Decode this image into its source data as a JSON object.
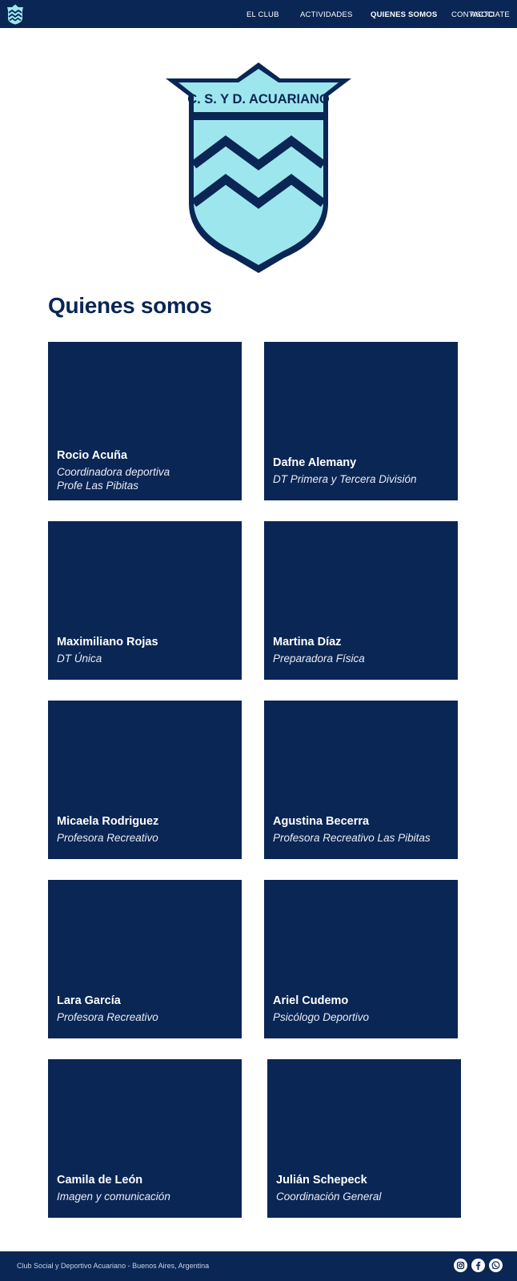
{
  "nav": {
    "items": [
      {
        "label": "EL CLUB"
      },
      {
        "label": "ACTIVIDADES"
      },
      {
        "label": "QUIENES SOMOS"
      },
      {
        "label": "CONTACTO"
      },
      {
        "label": "ASOCIATE"
      }
    ],
    "active_index": 2
  },
  "crest": {
    "text": "C. S. Y D. ACUARIANO"
  },
  "section": {
    "title": "Quienes somos"
  },
  "team": [
    {
      "name": "Rocio Acuña",
      "role": "Coordinadora deportiva\nProfe Las Pibitas"
    },
    {
      "name": "Dafne Alemany",
      "role": "DT Primera y Tercera División"
    },
    {
      "name": "Maximiliano Rojas",
      "role": "DT Única"
    },
    {
      "name": "Martina Díaz",
      "role": "Preparadora Física"
    },
    {
      "name": "Micaela Rodriguez",
      "role": "Profesora Recreativo"
    },
    {
      "name": "Agustina Becerra",
      "role": "Profesora Recreativo Las Pibitas"
    },
    {
      "name": "Lara García",
      "role": "Profesora Recreativo"
    },
    {
      "name": "Ariel Cudemo",
      "role": "Psicólogo Deportivo"
    },
    {
      "name": "Camila de León",
      "role": "Imagen y comunicación"
    },
    {
      "name": "Julián Schepeck",
      "role": "Coordinación General"
    }
  ],
  "footer": {
    "text": "Club Social y Deportivo Acuariano - Buenos Aires, Argentina",
    "social": [
      {
        "icon": "instagram-icon"
      },
      {
        "icon": "facebook-icon"
      },
      {
        "icon": "whatsapp-icon"
      }
    ]
  },
  "colors": {
    "navy": "#0a2654",
    "light_blue": "#9de6ee",
    "white": "#ffffff"
  }
}
